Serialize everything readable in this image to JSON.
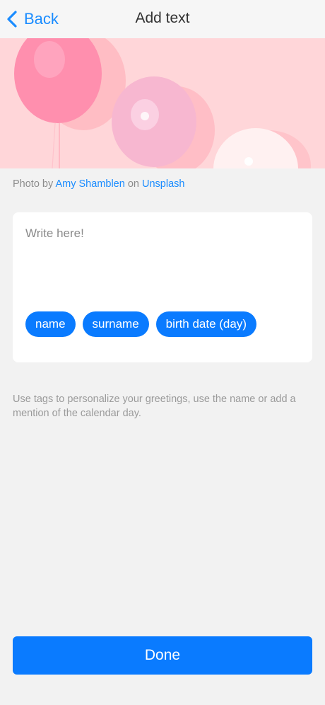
{
  "nav": {
    "back_label": "Back",
    "title": "Add text"
  },
  "banner": {
    "icon": "balloons-photo",
    "colors": {
      "background": "#ffd6d9",
      "balloon_pink": "#ff8fae",
      "balloon_light": "#f7b7d0",
      "balloon_white": "#fff1f1"
    }
  },
  "credit": {
    "prefix": "Photo by",
    "author": "Amy Shamblen",
    "middle": "on",
    "source": "Unsplash"
  },
  "editor": {
    "placeholder": "Write here!"
  },
  "tags": [
    {
      "label": "name"
    },
    {
      "label": "surname"
    },
    {
      "label": "birth date (day)"
    }
  ],
  "tip": "Use tags to personalize your greetings, use the name or add a mention of the calendar day.",
  "done_label": "Done",
  "colors": {
    "accent": "#0a7bff",
    "link": "#1a8cff",
    "background": "#f2f2f2"
  }
}
